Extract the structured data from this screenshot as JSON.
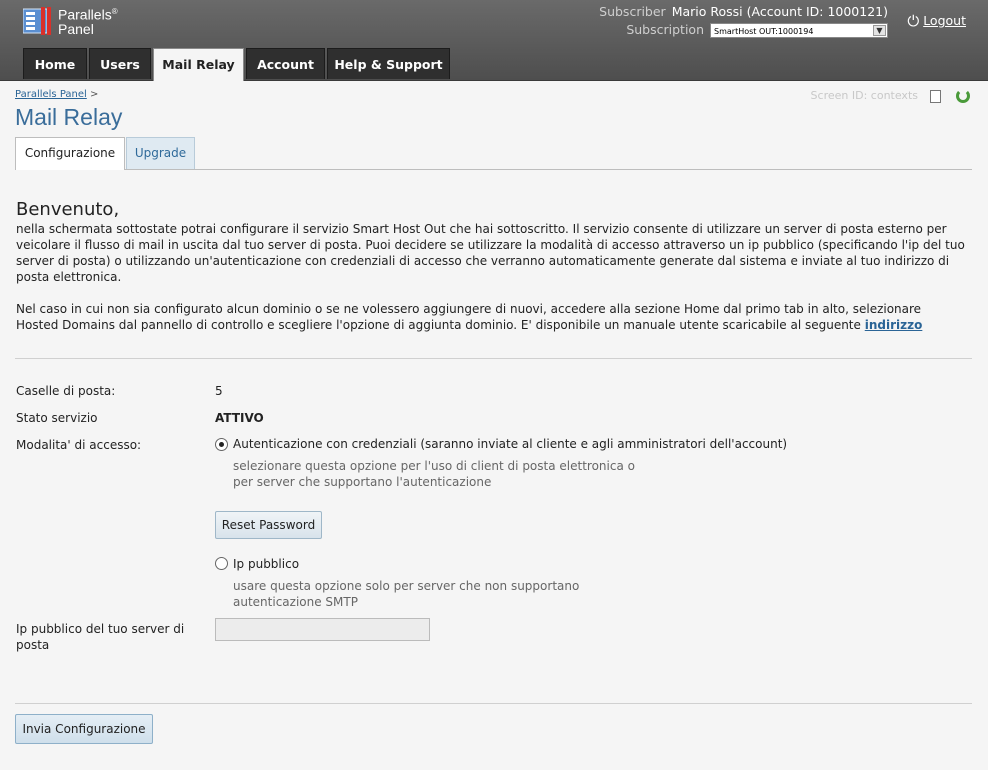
{
  "brand": {
    "line1": "Parallels",
    "line2": "Panel",
    "reg": "®"
  },
  "subscriber": {
    "label": "Subscriber",
    "value": "Mario Rossi (Account ID: 1000121)",
    "subscription_label": "Subscription",
    "subscription_value": "SmartHost OUT:1000194"
  },
  "logout": "Logout",
  "nav": {
    "home": "Home",
    "users": "Users",
    "mail_relay": "Mail Relay",
    "account": "Account",
    "help": "Help & Support"
  },
  "breadcrumb": {
    "root": "Parallels Panel",
    "sep": ">"
  },
  "page_title": "Mail Relay",
  "screen_id": {
    "label": "Screen ID:",
    "value": "contexts"
  },
  "tabs": {
    "config": "Configurazione",
    "upgrade": "Upgrade"
  },
  "welcome": {
    "title": "Benvenuto,",
    "para1": "nella schermata sottostate potrai configurare il servizio Smart Host Out che hai sottoscritto. Il servizio consente di utilizzare un server di posta esterno per veicolare il flusso di mail in uscita dal tuo server di posta. Puoi decidere se utilizzare la modalità di accesso attraverso un ip pubblico (specificando l'ip del tuo server di posta) o utilizzando un'autenticazione con credenziali di accesso che verranno automaticamente generate dal sistema e inviate al tuo indirizzo di posta elettronica.",
    "para2": "Nel caso in cui non sia configurato alcun dominio o se ne volessero aggiungere di nuovi, accedere alla sezione Home dal primo tab in alto, selezionare Hosted Domains dal pannello di controllo e scegliere l'opzione di aggiunta dominio. E' disponibile un manuale utente scaricabile al seguente",
    "link": "indirizzo"
  },
  "fields": {
    "mailboxes_label": "Caselle di posta:",
    "mailboxes_value": "5",
    "status_label": "Stato servizio",
    "status_value": "ATTIVO",
    "mode_label": "Modalita' di accesso:",
    "ip_label": "Ip pubblico del tuo server di posta"
  },
  "options": {
    "auth": {
      "label": "Autenticazione con credenziali (saranno inviate al cliente e agli amministratori dell'account)",
      "hint1": "selezionare questa opzione per l'uso di client di posta elettronica o",
      "hint2": "per server che supportano l'autenticazione",
      "checked": true
    },
    "reset_button": "Reset Password",
    "ip": {
      "label": "Ip pubblico",
      "hint1": "usare questa opzione solo per server che non supportano",
      "hint2": "autenticazione SMTP",
      "checked": false
    }
  },
  "ip_input": {
    "value": ""
  },
  "submit_button": "Invia Configurazione"
}
